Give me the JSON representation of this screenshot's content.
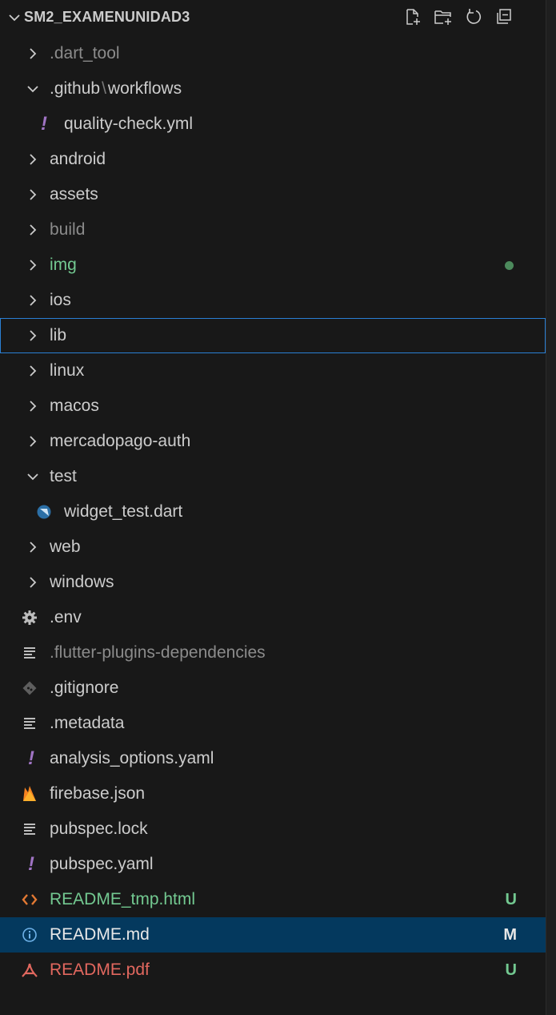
{
  "explorer": {
    "title": "SM2_EXAMENUNIDAD3",
    "actions": [
      {
        "name": "new-file-icon"
      },
      {
        "name": "new-folder-icon"
      },
      {
        "name": "refresh-icon"
      },
      {
        "name": "collapse-all-icon"
      }
    ],
    "items": [
      {
        "label": ".dart_tool"
      },
      {
        "label_part1": ".github",
        "label_sep": "\\",
        "label_part2": "workflows"
      },
      {
        "label": "quality-check.yml"
      },
      {
        "label": "android"
      },
      {
        "label": "assets"
      },
      {
        "label": "build"
      },
      {
        "label": "img"
      },
      {
        "label": "ios"
      },
      {
        "label": "lib"
      },
      {
        "label": "linux"
      },
      {
        "label": "macos"
      },
      {
        "label": "mercadopago-auth"
      },
      {
        "label": "test"
      },
      {
        "label": "widget_test.dart"
      },
      {
        "label": "web"
      },
      {
        "label": "windows"
      },
      {
        "label": ".env"
      },
      {
        "label": ".flutter-plugins-dependencies"
      },
      {
        "label": ".gitignore"
      },
      {
        "label": ".metadata"
      },
      {
        "label": "analysis_options.yaml"
      },
      {
        "label": "firebase.json"
      },
      {
        "label": "pubspec.lock"
      },
      {
        "label": "pubspec.yaml"
      },
      {
        "label": "README_tmp.html",
        "status": "U"
      },
      {
        "label": "README.md",
        "status": "M"
      },
      {
        "label": "README.pdf",
        "status": "U"
      }
    ]
  },
  "colors": {
    "background": "#181818",
    "selected": "#04395e",
    "focus_border": "#2a7fd4",
    "untracked": "#73c991",
    "ignored": "#8b8b8b",
    "pdf": "#e2685f",
    "yaml_icon": "#a074c4"
  }
}
